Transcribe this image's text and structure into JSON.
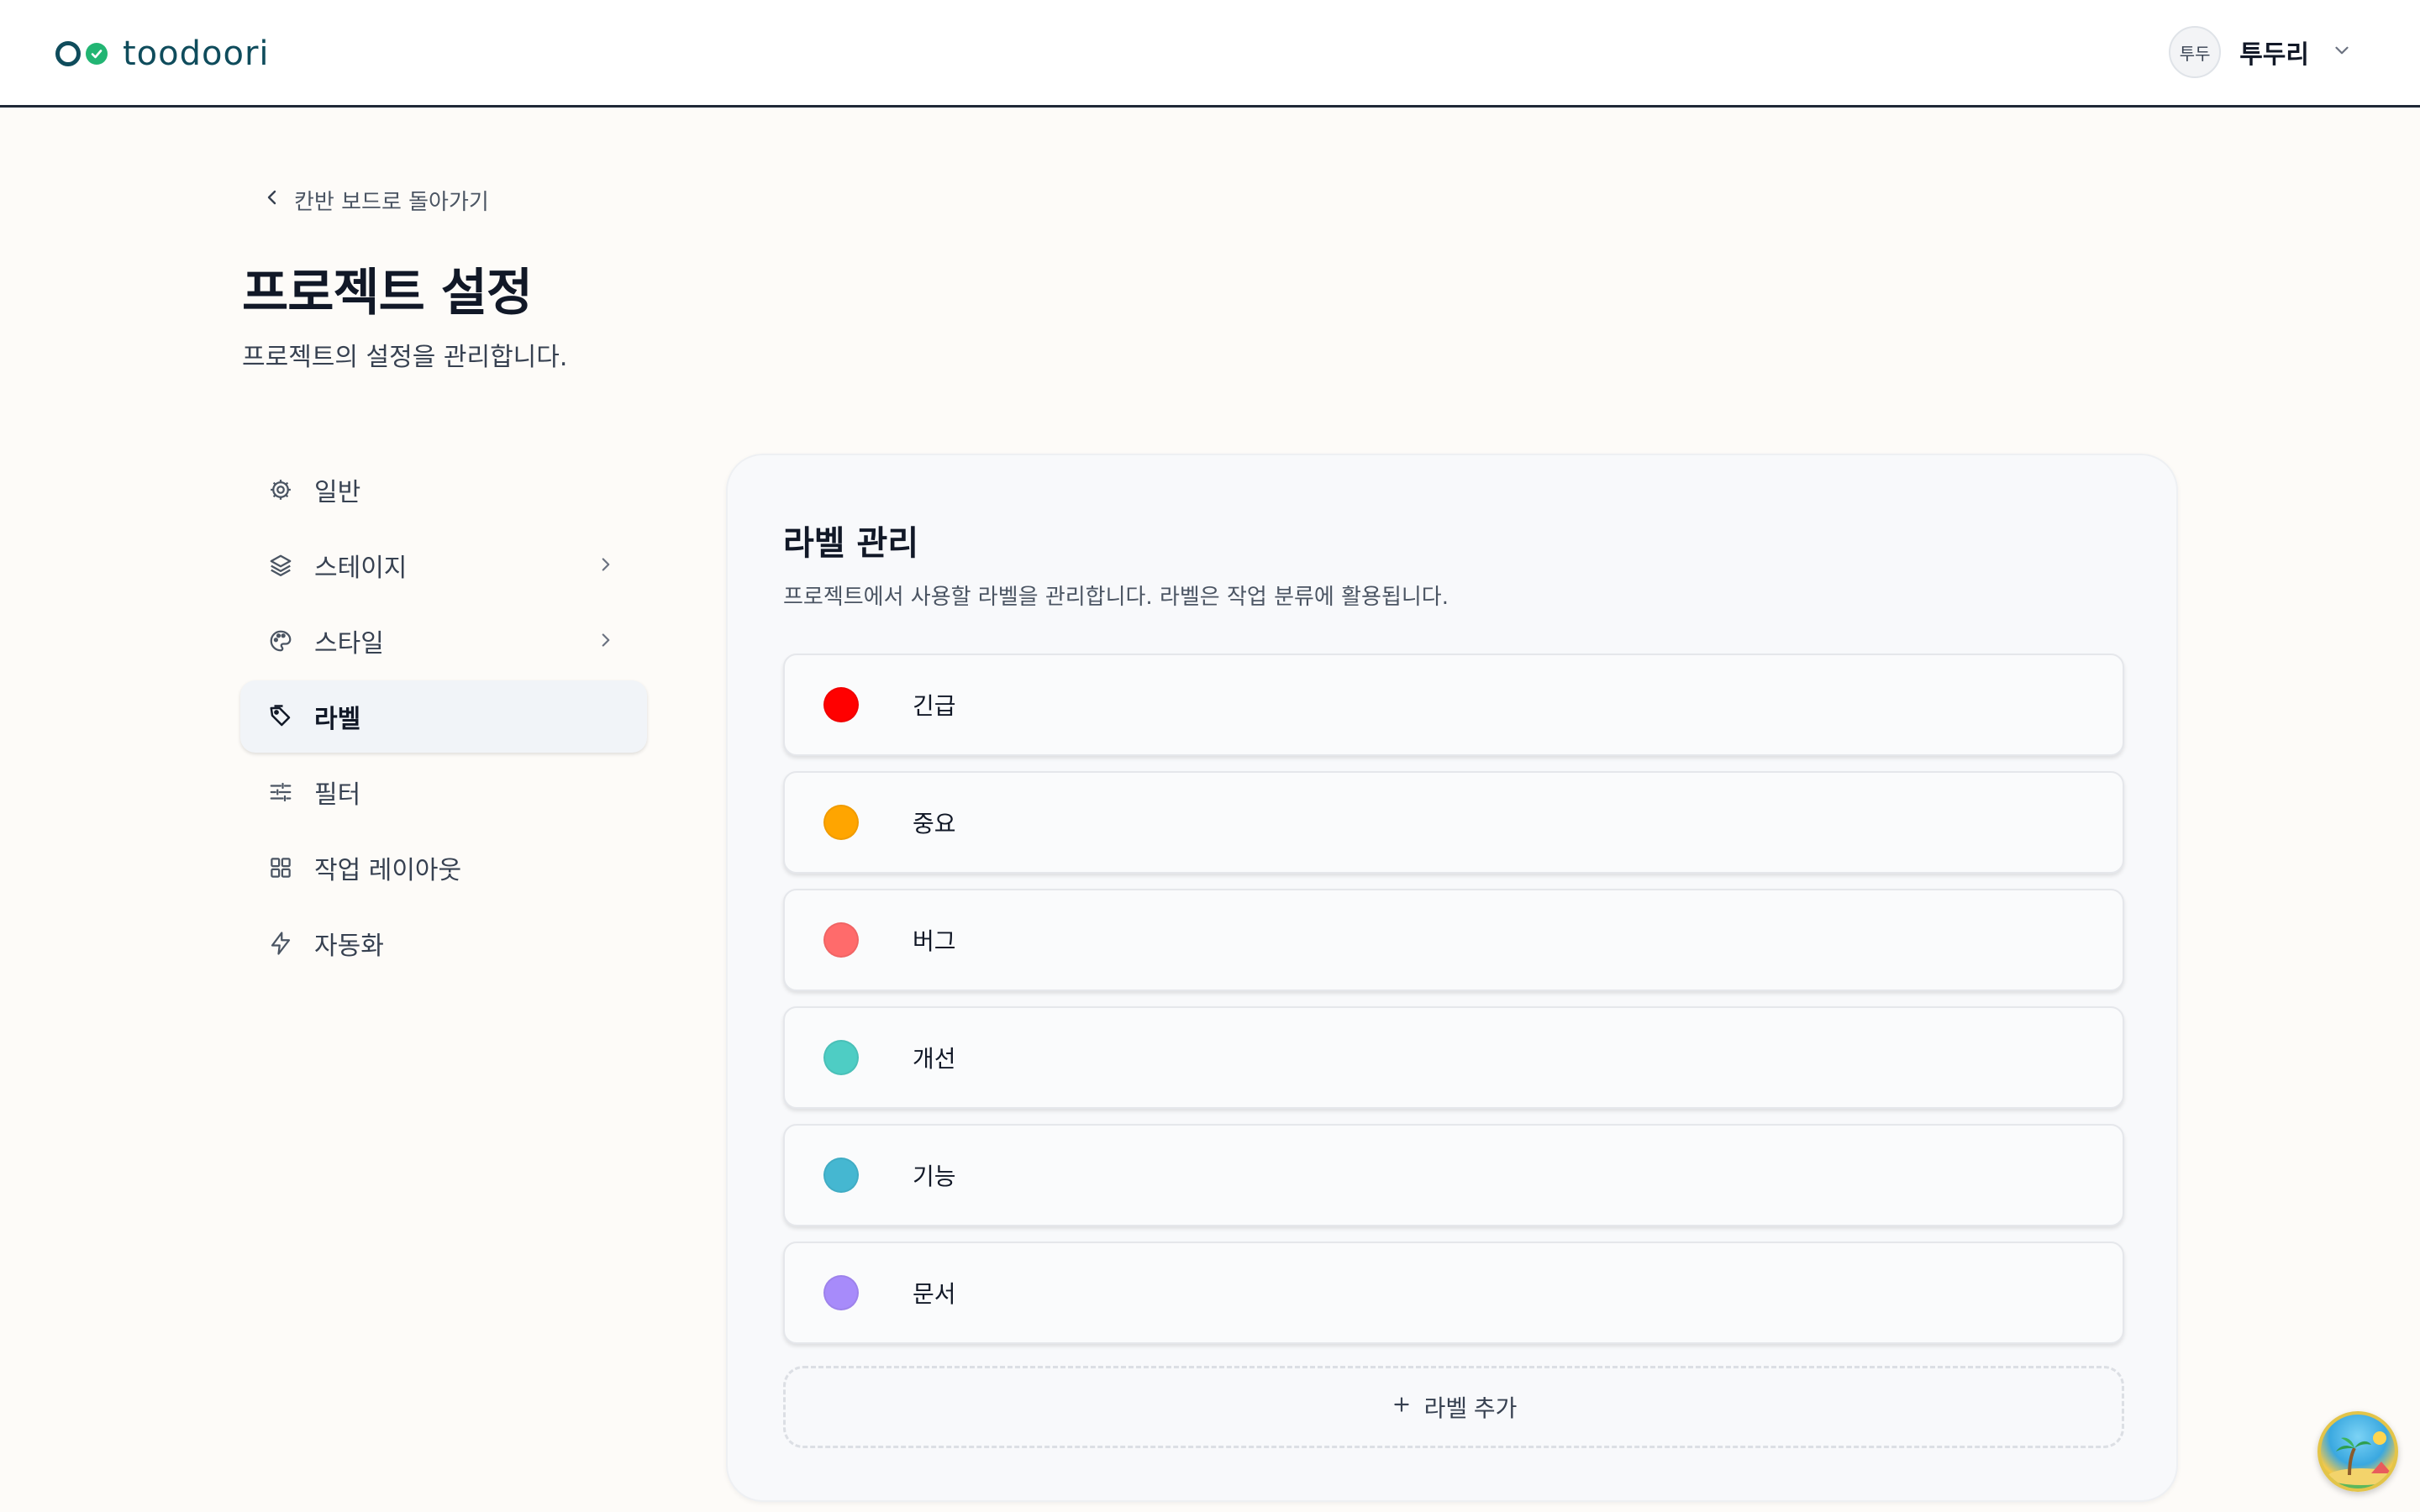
{
  "app": {
    "logo_text": "toodoori"
  },
  "user": {
    "avatar_text": "투두",
    "name": "투두리"
  },
  "back_link": "칸반 보드로 돌아가기",
  "page": {
    "title": "프로젝트 설정",
    "subtitle": "프로젝트의 설정을 관리합니다."
  },
  "sidebar": {
    "items": [
      {
        "label": "일반",
        "icon": "gear-icon",
        "chevron": false,
        "active": false
      },
      {
        "label": "스테이지",
        "icon": "layers-icon",
        "chevron": true,
        "active": false
      },
      {
        "label": "스타일",
        "icon": "palette-icon",
        "chevron": true,
        "active": false
      },
      {
        "label": "라벨",
        "icon": "tag-icon",
        "chevron": false,
        "active": true
      },
      {
        "label": "필터",
        "icon": "sliders-icon",
        "chevron": false,
        "active": false
      },
      {
        "label": "작업 레이아웃",
        "icon": "grid-icon",
        "chevron": false,
        "active": false
      },
      {
        "label": "자동화",
        "icon": "lightning-icon",
        "chevron": false,
        "active": false
      }
    ]
  },
  "panel": {
    "title": "라벨 관리",
    "description": "프로젝트에서 사용할 라벨을 관리합니다. 라벨은 작업 분류에 활용됩니다.",
    "labels": [
      {
        "name": "긴급",
        "color": "#ff0000"
      },
      {
        "name": "중요",
        "color": "#ffa500"
      },
      {
        "name": "버그",
        "color": "#ff6b6b"
      },
      {
        "name": "개선",
        "color": "#4ecdc4"
      },
      {
        "name": "기능",
        "color": "#45b7d1"
      },
      {
        "name": "문서",
        "color": "#a78bfa"
      }
    ],
    "add_label": "라벨 추가"
  },
  "colors": {
    "brand": "#0f4c5c",
    "check": "#22b573"
  }
}
